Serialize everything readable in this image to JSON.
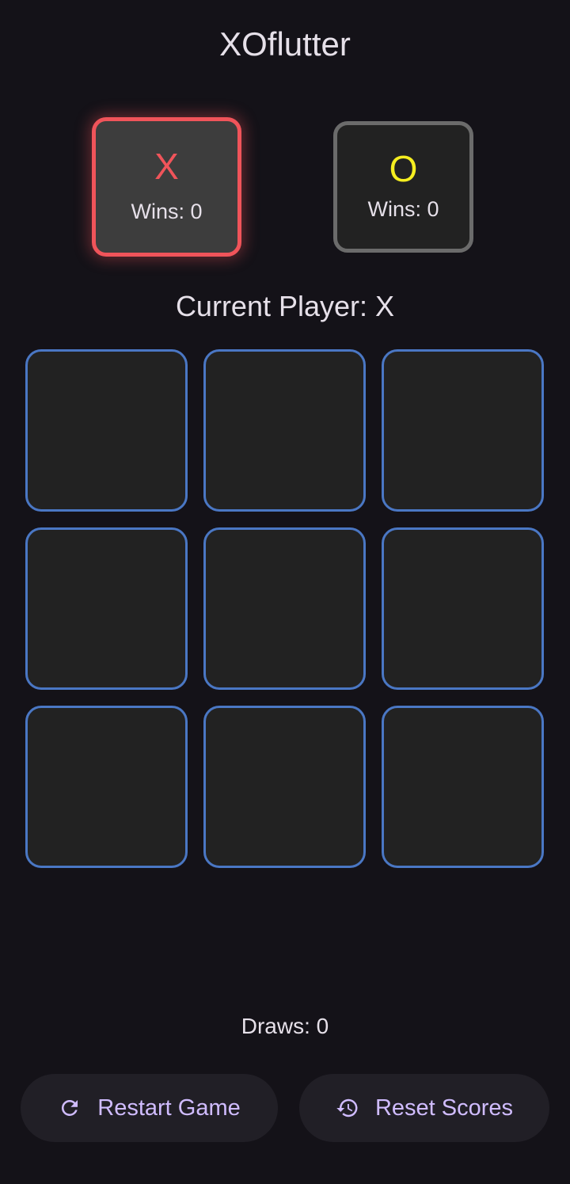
{
  "app": {
    "title": "XOflutter"
  },
  "players": [
    {
      "symbol": "X",
      "wins_label": "Wins: 0",
      "active": true,
      "color": "#f0545a"
    },
    {
      "symbol": "O",
      "wins_label": "Wins: 0",
      "active": false,
      "color": "#f5ee20"
    }
  ],
  "status": {
    "current_player": "Current Player: X"
  },
  "board": {
    "cells": [
      "",
      "",
      "",
      "",
      "",
      "",
      "",
      "",
      ""
    ],
    "cell_border_color": "#4a77c4"
  },
  "draws_label": "Draws: 0",
  "actions": {
    "restart_label": "Restart Game",
    "restart_icon": "refresh-icon",
    "reset_label": "Reset Scores",
    "reset_icon": "history-icon",
    "accent_color": "#d0bcff"
  }
}
